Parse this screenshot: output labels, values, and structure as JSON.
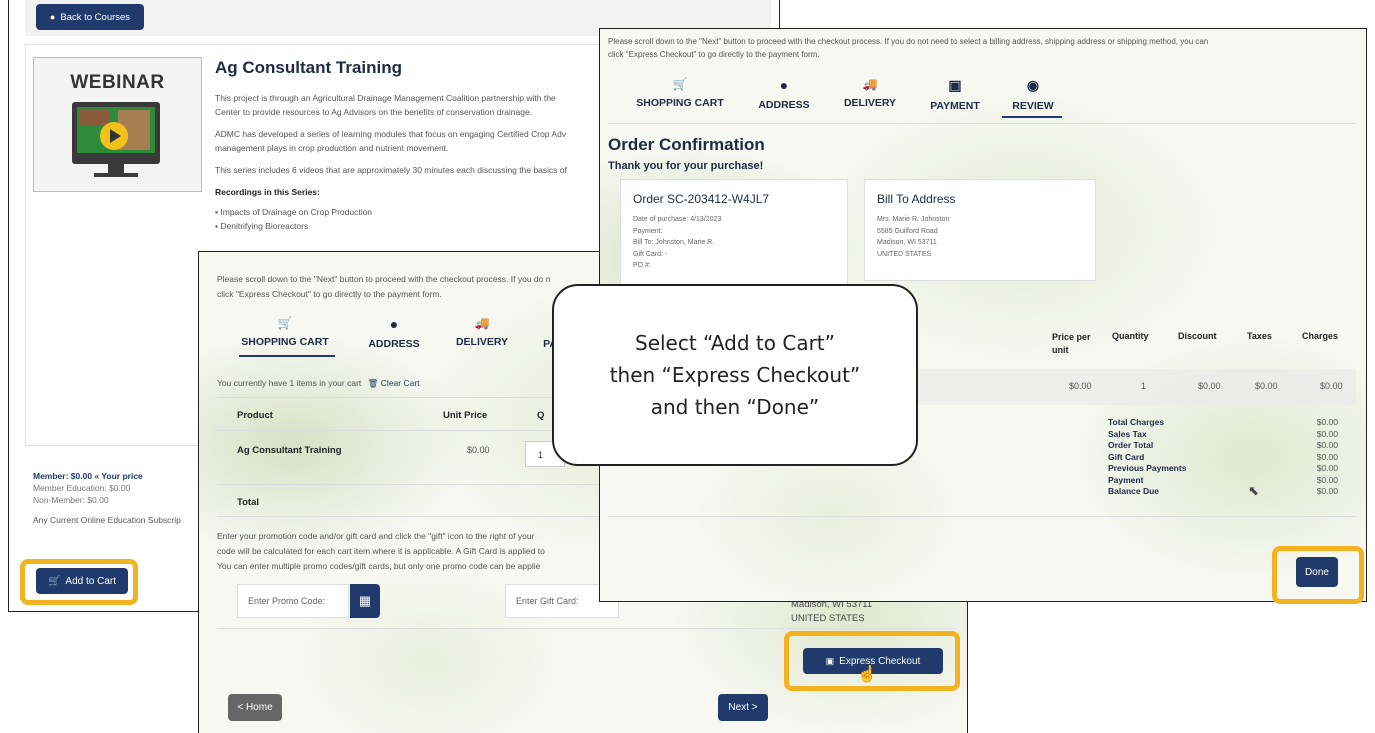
{
  "course": {
    "back_label": "Back to Courses",
    "thumb_label": "WEBINAR",
    "title": "Ag Consultant Training",
    "desc1_line1": "This project is through an Agricultural Drainage Management Coalition partnership with the",
    "desc1_line2": "Center to provide resources to Ag Advisors on the benefits of conservation drainage.",
    "desc2_line1": "ADMC has developed a series of learning modules that focus on engaging Certified Crop Adv",
    "desc2_line2": "management plays in crop production and nutrient movement.",
    "desc3": "This series includes 6 videos that are approximately 30 minutes each discussing the basics of",
    "recordings_heading": "Recordings in this Series:",
    "recordings": [
      "Impacts of Drainage on Crop Production",
      "Denitrifying Bioreactors"
    ],
    "price_member": "Member: $0.00",
    "price_your": "« Your price",
    "price_member_edu": "Member Education: $0.00",
    "price_nonmember": "Non-Member: $0.00",
    "subscription": "Any Current Online Education Subscrip",
    "add_to_cart": "Add to Cart"
  },
  "cart": {
    "instructions_line1": "Please scroll down to the \"Next\" button to proceed with the checkout process. If you do n",
    "instructions_line2": "click \"Express Checkout\" to go directly to the payment form.",
    "tabs": [
      {
        "label": "SHOPPING CART",
        "icon": "shopping-cart-icon",
        "glyph": "🛒"
      },
      {
        "label": "ADDRESS",
        "icon": "map-marker-icon",
        "glyph": "●"
      },
      {
        "label": "DELIVERY",
        "icon": "truck-icon",
        "glyph": "🚚"
      },
      {
        "label": "PA",
        "icon": "payment-icon",
        "glyph": ""
      }
    ],
    "items_text": "You currently have 1 items in your cart",
    "clear_cart": "Clear Cart",
    "col_product": "Product",
    "col_unit_price": "Unit Price",
    "col_qty": "Q",
    "row_product": "Ag Consultant Training",
    "row_price": "$0.00",
    "row_qty": "1",
    "total_label": "Total",
    "promo_line1": "Enter your promotion code and/or gift card and click the \"gift\" icon to the right of your",
    "promo_line2": "code will be calculated for each cart item where it is applicable. A Gift Card is applied to",
    "promo_line3": "You can enter multiple promo codes/gift cards, but only one promo code can be applie",
    "promo_placeholder": "Enter Promo Code:",
    "gift_placeholder": "Enter Gift Card:",
    "addr_line1": "Madison, WI 53711",
    "addr_line2": "UNITED STATES",
    "express_checkout": "Express Checkout",
    "home": "< Home",
    "next": "Next >"
  },
  "review": {
    "instructions_line1": "Please scroll down to the \"Next\" button to proceed with the checkout process. If you do not need to select a billing address, shipping address or shipping method, you can",
    "instructions_line2": "click \"Express Checkout\" to go directly to the payment form.",
    "tabs": [
      {
        "label": "SHOPPING CART",
        "icon": "shopping-cart-icon",
        "glyph": "🛒"
      },
      {
        "label": "ADDRESS",
        "icon": "map-marker-icon",
        "glyph": "●"
      },
      {
        "label": "DELIVERY",
        "icon": "truck-icon",
        "glyph": "🚚"
      },
      {
        "label": "PAYMENT",
        "icon": "money-icon",
        "glyph": "▣"
      },
      {
        "label": "REVIEW",
        "icon": "eye-icon",
        "glyph": "◉"
      }
    ],
    "heading": "Order Confirmation",
    "thanks": "Thank you for your purchase!",
    "order_number": "Order SC-203412-W4JL7",
    "order_date": "Date of purchase: 4/13/2023",
    "payment_label": "Payment:",
    "bill_to": "Bill To: Johnston, Marie R.",
    "gift_card": "Gift Card: -",
    "po": "PO #:",
    "bill_heading": "Bill To Address",
    "bill_lines": [
      "Mrs. Marie R. Johnston",
      "5585 Guilford Road",
      "Madison, WI 53711",
      "UNITED STATES"
    ],
    "columns": [
      "Price per unit",
      "Quantity",
      "Discount",
      "Taxes",
      "Charges"
    ],
    "row": [
      "$0.00",
      "1",
      "$0.00",
      "$0.00",
      "$0.00"
    ],
    "totals": [
      {
        "label": "Total Charges",
        "value": "$0.00"
      },
      {
        "label": "Sales Tax",
        "value": "$0.00"
      },
      {
        "label": "Order Total",
        "value": "$0.00"
      },
      {
        "label": "Gift Card",
        "value": "$0.00"
      },
      {
        "label": "Previous Payments",
        "value": "$0.00"
      },
      {
        "label": "Payment",
        "value": "$0.00"
      },
      {
        "label": "Balance Due",
        "value": "$0.00"
      }
    ],
    "done": "Done"
  },
  "callout": {
    "line1": "Select “Add to Cart”",
    "line2": "then “Express Checkout”",
    "line3": "and then “Done”"
  },
  "colors": {
    "navy": "#1f3a6b",
    "highlight": "#f3b321",
    "home_gray": "#666666"
  }
}
